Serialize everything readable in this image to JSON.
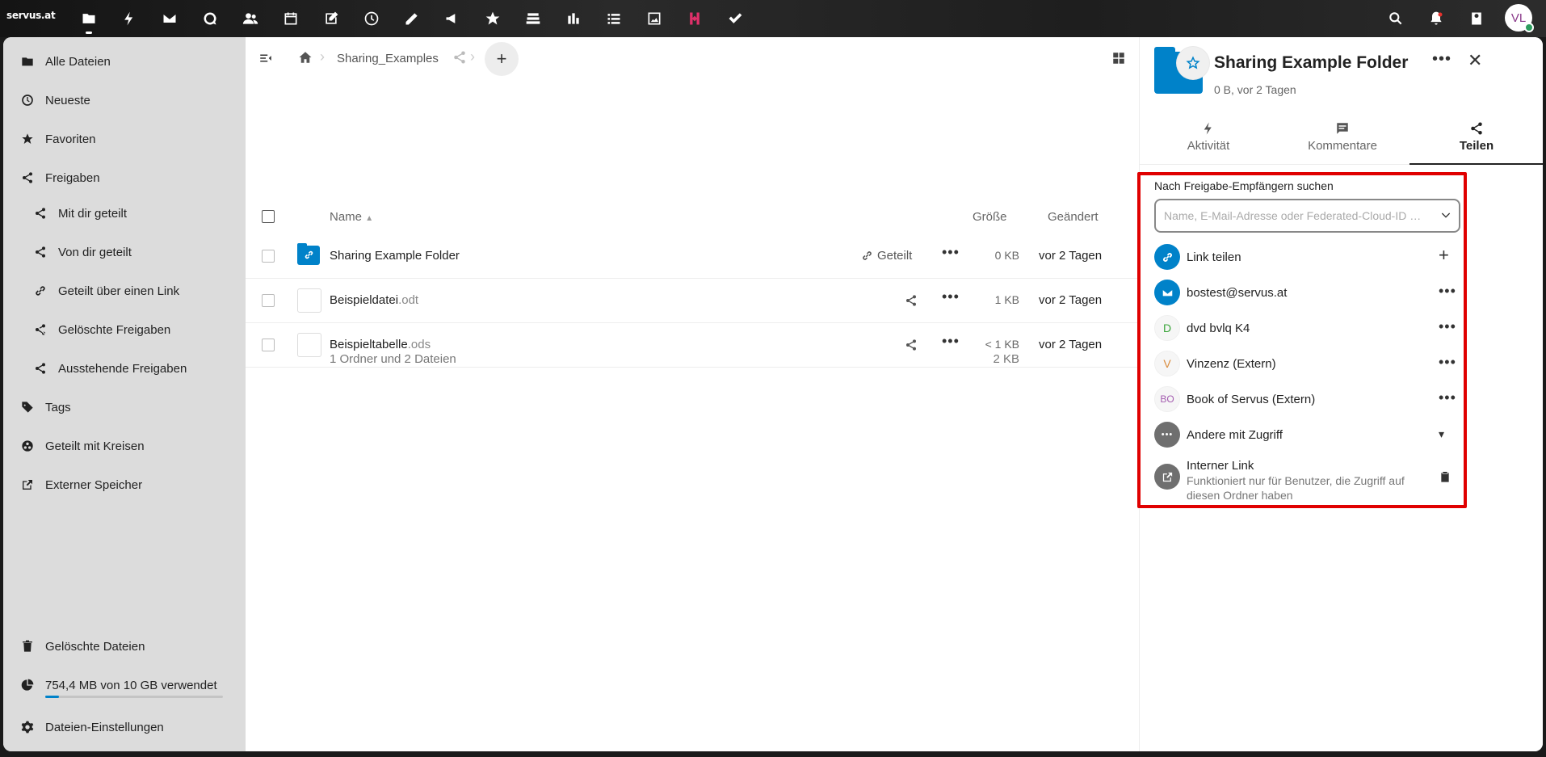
{
  "topbar": {
    "logo_text": "servus.at",
    "apps": [
      {
        "name": "files-icon",
        "active": true
      },
      {
        "name": "activity-icon"
      },
      {
        "name": "mail-icon"
      },
      {
        "name": "talk-icon"
      },
      {
        "name": "contacts-icon"
      },
      {
        "name": "calendar-icon"
      },
      {
        "name": "notes-icon"
      },
      {
        "name": "clock-icon"
      },
      {
        "name": "edit-icon"
      },
      {
        "name": "announcement-icon"
      },
      {
        "name": "star-icon"
      },
      {
        "name": "deck-icon"
      },
      {
        "name": "analytics-icon"
      },
      {
        "name": "list-icon"
      },
      {
        "name": "photos-icon"
      },
      {
        "name": "collectives-icon"
      },
      {
        "name": "tasks-icon"
      }
    ],
    "avatar_initials": "VL"
  },
  "nav": {
    "items": [
      {
        "label": "Alle Dateien",
        "icon": "folder-icon"
      },
      {
        "label": "Neueste",
        "icon": "clock-icon"
      },
      {
        "label": "Favoriten",
        "icon": "star-icon"
      },
      {
        "label": "Freigaben",
        "icon": "share-icon"
      },
      {
        "label": "Mit dir geteilt",
        "icon": "share-icon"
      },
      {
        "label": "Von dir geteilt",
        "icon": "share-icon"
      },
      {
        "label": "Geteilt über einen Link",
        "icon": "link-icon"
      },
      {
        "label": "Gelöschte Freigaben",
        "icon": "share-deleted-icon"
      },
      {
        "label": "Ausstehende Freigaben",
        "icon": "share-icon"
      },
      {
        "label": "Tags",
        "icon": "tag-icon"
      },
      {
        "label": "Geteilt mit Kreisen",
        "icon": "circles-icon"
      },
      {
        "label": "Externer Speicher",
        "icon": "external-icon"
      }
    ],
    "deleted_files": "Gelöschte Dateien",
    "quota": "754,4 MB von 10 GB verwendet",
    "quota_fraction": 0.075,
    "settings": "Dateien-Einstellungen"
  },
  "files": {
    "breadcrumb": "Sharing_Examples",
    "new_label": "+",
    "columns": {
      "name": "Name",
      "size": "Größe",
      "modified": "Geändert"
    },
    "rows": [
      {
        "name": "Sharing Example Folder",
        "ext": "",
        "shared_label": "Geteilt",
        "size": "0 KB",
        "modified": "vor 2 Tagen"
      },
      {
        "name": "Beispieldatei",
        "ext": ".odt",
        "size": "1 KB",
        "modified": "vor 2 Tagen"
      },
      {
        "name": "Beispieltabelle",
        "ext": ".ods",
        "size": "< 1 KB",
        "modified": "vor 2 Tagen"
      }
    ],
    "summary": "1 Ordner und 2 Dateien",
    "summary_size": "2 KB"
  },
  "details": {
    "title": "Sharing Example Folder",
    "subtitle": "0 B, vor 2 Tagen",
    "tabs": [
      {
        "label": "Aktivität",
        "icon": "activity-icon"
      },
      {
        "label": "Kommentare",
        "icon": "comment-icon"
      },
      {
        "label": "Teilen",
        "icon": "share-icon",
        "active": true
      }
    ],
    "search_label": "Nach Freigabe-Empfängern suchen",
    "search_placeholder": "Name, E-Mail-Adresse oder Federated-Cloud-ID …",
    "shares": [
      {
        "name": "Link teilen",
        "avatar": "link-icon",
        "action": "+"
      },
      {
        "name": "bostest@servus.at",
        "avatar": "mail-icon",
        "action": "•••"
      },
      {
        "name": "dvd bvlq K4",
        "initials": "D",
        "color": "#3aa53a",
        "action": "•••"
      },
      {
        "name": "Vinzenz (Extern)",
        "initials": "V",
        "color": "#d98a3a",
        "action": "•••"
      },
      {
        "name": "Book of Servus (Extern)",
        "initials": "BO",
        "color": "#a45cb0",
        "action": "•••"
      },
      {
        "name": "Andere mit Zugriff",
        "avatar": "dots-icon",
        "action": "▾"
      }
    ],
    "internal_link_title": "Interner Link",
    "internal_link_sub": "Funktioniert nur für Benutzer, die Zugriff auf diesen Ordner haben"
  },
  "colors": {
    "accent": "#0082c9",
    "highlight_border": "#e00000"
  }
}
